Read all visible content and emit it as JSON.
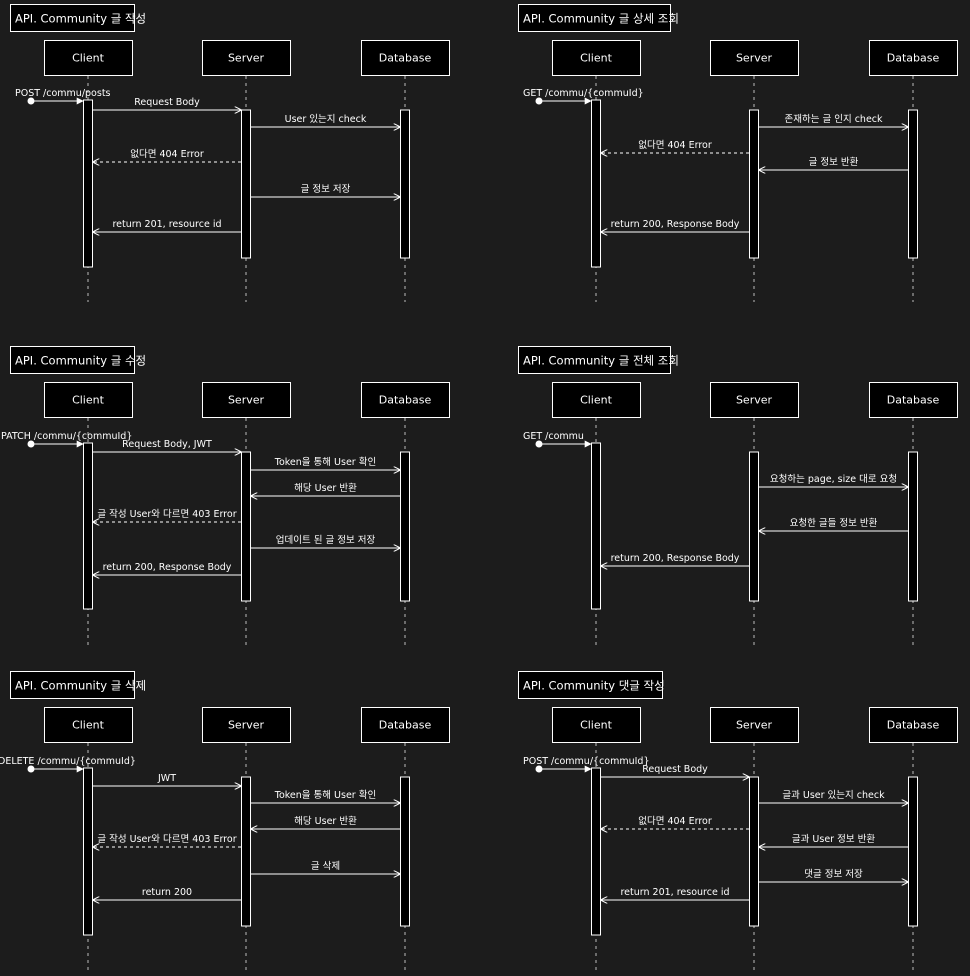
{
  "participants": [
    "Client",
    "Server",
    "Database"
  ],
  "diagrams": [
    {
      "title": "API. Community 글 작성",
      "messages": [
        {
          "text": "POST /commu/posts",
          "from": "start",
          "to": "Client",
          "style": "solid"
        },
        {
          "text": "Request Body",
          "from": "Client",
          "to": "Server",
          "style": "solid"
        },
        {
          "text": "User 있는지 check",
          "from": "Server",
          "to": "Database",
          "style": "solid"
        },
        {
          "text": "없다면 404 Error",
          "from": "Server",
          "to": "Client",
          "style": "dashed"
        },
        {
          "text": "글 정보 저장",
          "from": "Server",
          "to": "Database",
          "style": "solid"
        },
        {
          "text": "return 201, resource id",
          "from": "Server",
          "to": "Client",
          "style": "solid"
        }
      ]
    },
    {
      "title": "API. Community 글 상세 조회",
      "messages": [
        {
          "text": "GET /commu/{commuId}",
          "from": "start",
          "to": "Client",
          "style": "solid"
        },
        {
          "text": "존재하는 글 인지 check",
          "from": "Server",
          "to": "Database",
          "style": "solid"
        },
        {
          "text": "없다면 404 Error",
          "from": "Server",
          "to": "Client",
          "style": "dashed"
        },
        {
          "text": "글 정보 반환",
          "from": "Database",
          "to": "Server",
          "style": "solid"
        },
        {
          "text": "return 200, Response Body",
          "from": "Server",
          "to": "Client",
          "style": "solid"
        }
      ]
    },
    {
      "title": "API. Community 글 수정",
      "messages": [
        {
          "text": "PATCH /commu/{commuId}",
          "from": "start",
          "to": "Client",
          "style": "solid"
        },
        {
          "text": "Request Body, JWT",
          "from": "Client",
          "to": "Server",
          "style": "solid"
        },
        {
          "text": "Token을 통해 User 확인",
          "from": "Server",
          "to": "Database",
          "style": "solid"
        },
        {
          "text": "해당 User 반환",
          "from": "Database",
          "to": "Server",
          "style": "solid"
        },
        {
          "text": "글 작성 User와 다르면 403 Error",
          "from": "Server",
          "to": "Client",
          "style": "dashed"
        },
        {
          "text": "업데이트 된 글 정보 저장",
          "from": "Server",
          "to": "Database",
          "style": "solid"
        },
        {
          "text": "return 200, Response Body",
          "from": "Server",
          "to": "Client",
          "style": "solid"
        }
      ]
    },
    {
      "title": "API. Community 글 전체 조회",
      "messages": [
        {
          "text": "GET /commu",
          "from": "start",
          "to": "Client",
          "style": "solid"
        },
        {
          "text": "요청하는 page, size 대로 요청",
          "from": "Server",
          "to": "Database",
          "style": "solid"
        },
        {
          "text": "요청한 글들 정보 반환",
          "from": "Database",
          "to": "Server",
          "style": "solid"
        },
        {
          "text": "return 200, Response Body",
          "from": "Server",
          "to": "Client",
          "style": "solid"
        }
      ]
    },
    {
      "title": "API. Community 글 삭제",
      "messages": [
        {
          "text": "DELETE /commu/{commuId}",
          "from": "start",
          "to": "Client",
          "style": "solid"
        },
        {
          "text": "JWT",
          "from": "Client",
          "to": "Server",
          "style": "solid"
        },
        {
          "text": "Token을 통해 User 확인",
          "from": "Server",
          "to": "Database",
          "style": "solid"
        },
        {
          "text": "해당 User 반환",
          "from": "Database",
          "to": "Server",
          "style": "solid"
        },
        {
          "text": "글 작성 User와 다르면 403 Error",
          "from": "Server",
          "to": "Client",
          "style": "dashed"
        },
        {
          "text": "글 삭제",
          "from": "Server",
          "to": "Database",
          "style": "solid"
        },
        {
          "text": "return 200",
          "from": "Server",
          "to": "Client",
          "style": "solid"
        }
      ]
    },
    {
      "title": "API. Community 댓글 작성",
      "messages": [
        {
          "text": "POST /commu/{commuId}",
          "from": "start",
          "to": "Client",
          "style": "solid"
        },
        {
          "text": "Request Body",
          "from": "Client",
          "to": "Server",
          "style": "solid"
        },
        {
          "text": "글과 User 있는지 check",
          "from": "Server",
          "to": "Database",
          "style": "solid"
        },
        {
          "text": "없다면 404 Error",
          "from": "Server",
          "to": "Client",
          "style": "dashed"
        },
        {
          "text": "글과 User 정보 반환",
          "from": "Database",
          "to": "Server",
          "style": "solid"
        },
        {
          "text": "댓글 정보 저장",
          "from": "Server",
          "to": "Database",
          "style": "solid"
        },
        {
          "text": "return 201, resource id",
          "from": "Server",
          "to": "Client",
          "style": "solid"
        }
      ]
    }
  ],
  "colors": {
    "background": "#1c1c1c",
    "box": "#000000",
    "line": "#ffffff",
    "text": "#ffffff"
  }
}
